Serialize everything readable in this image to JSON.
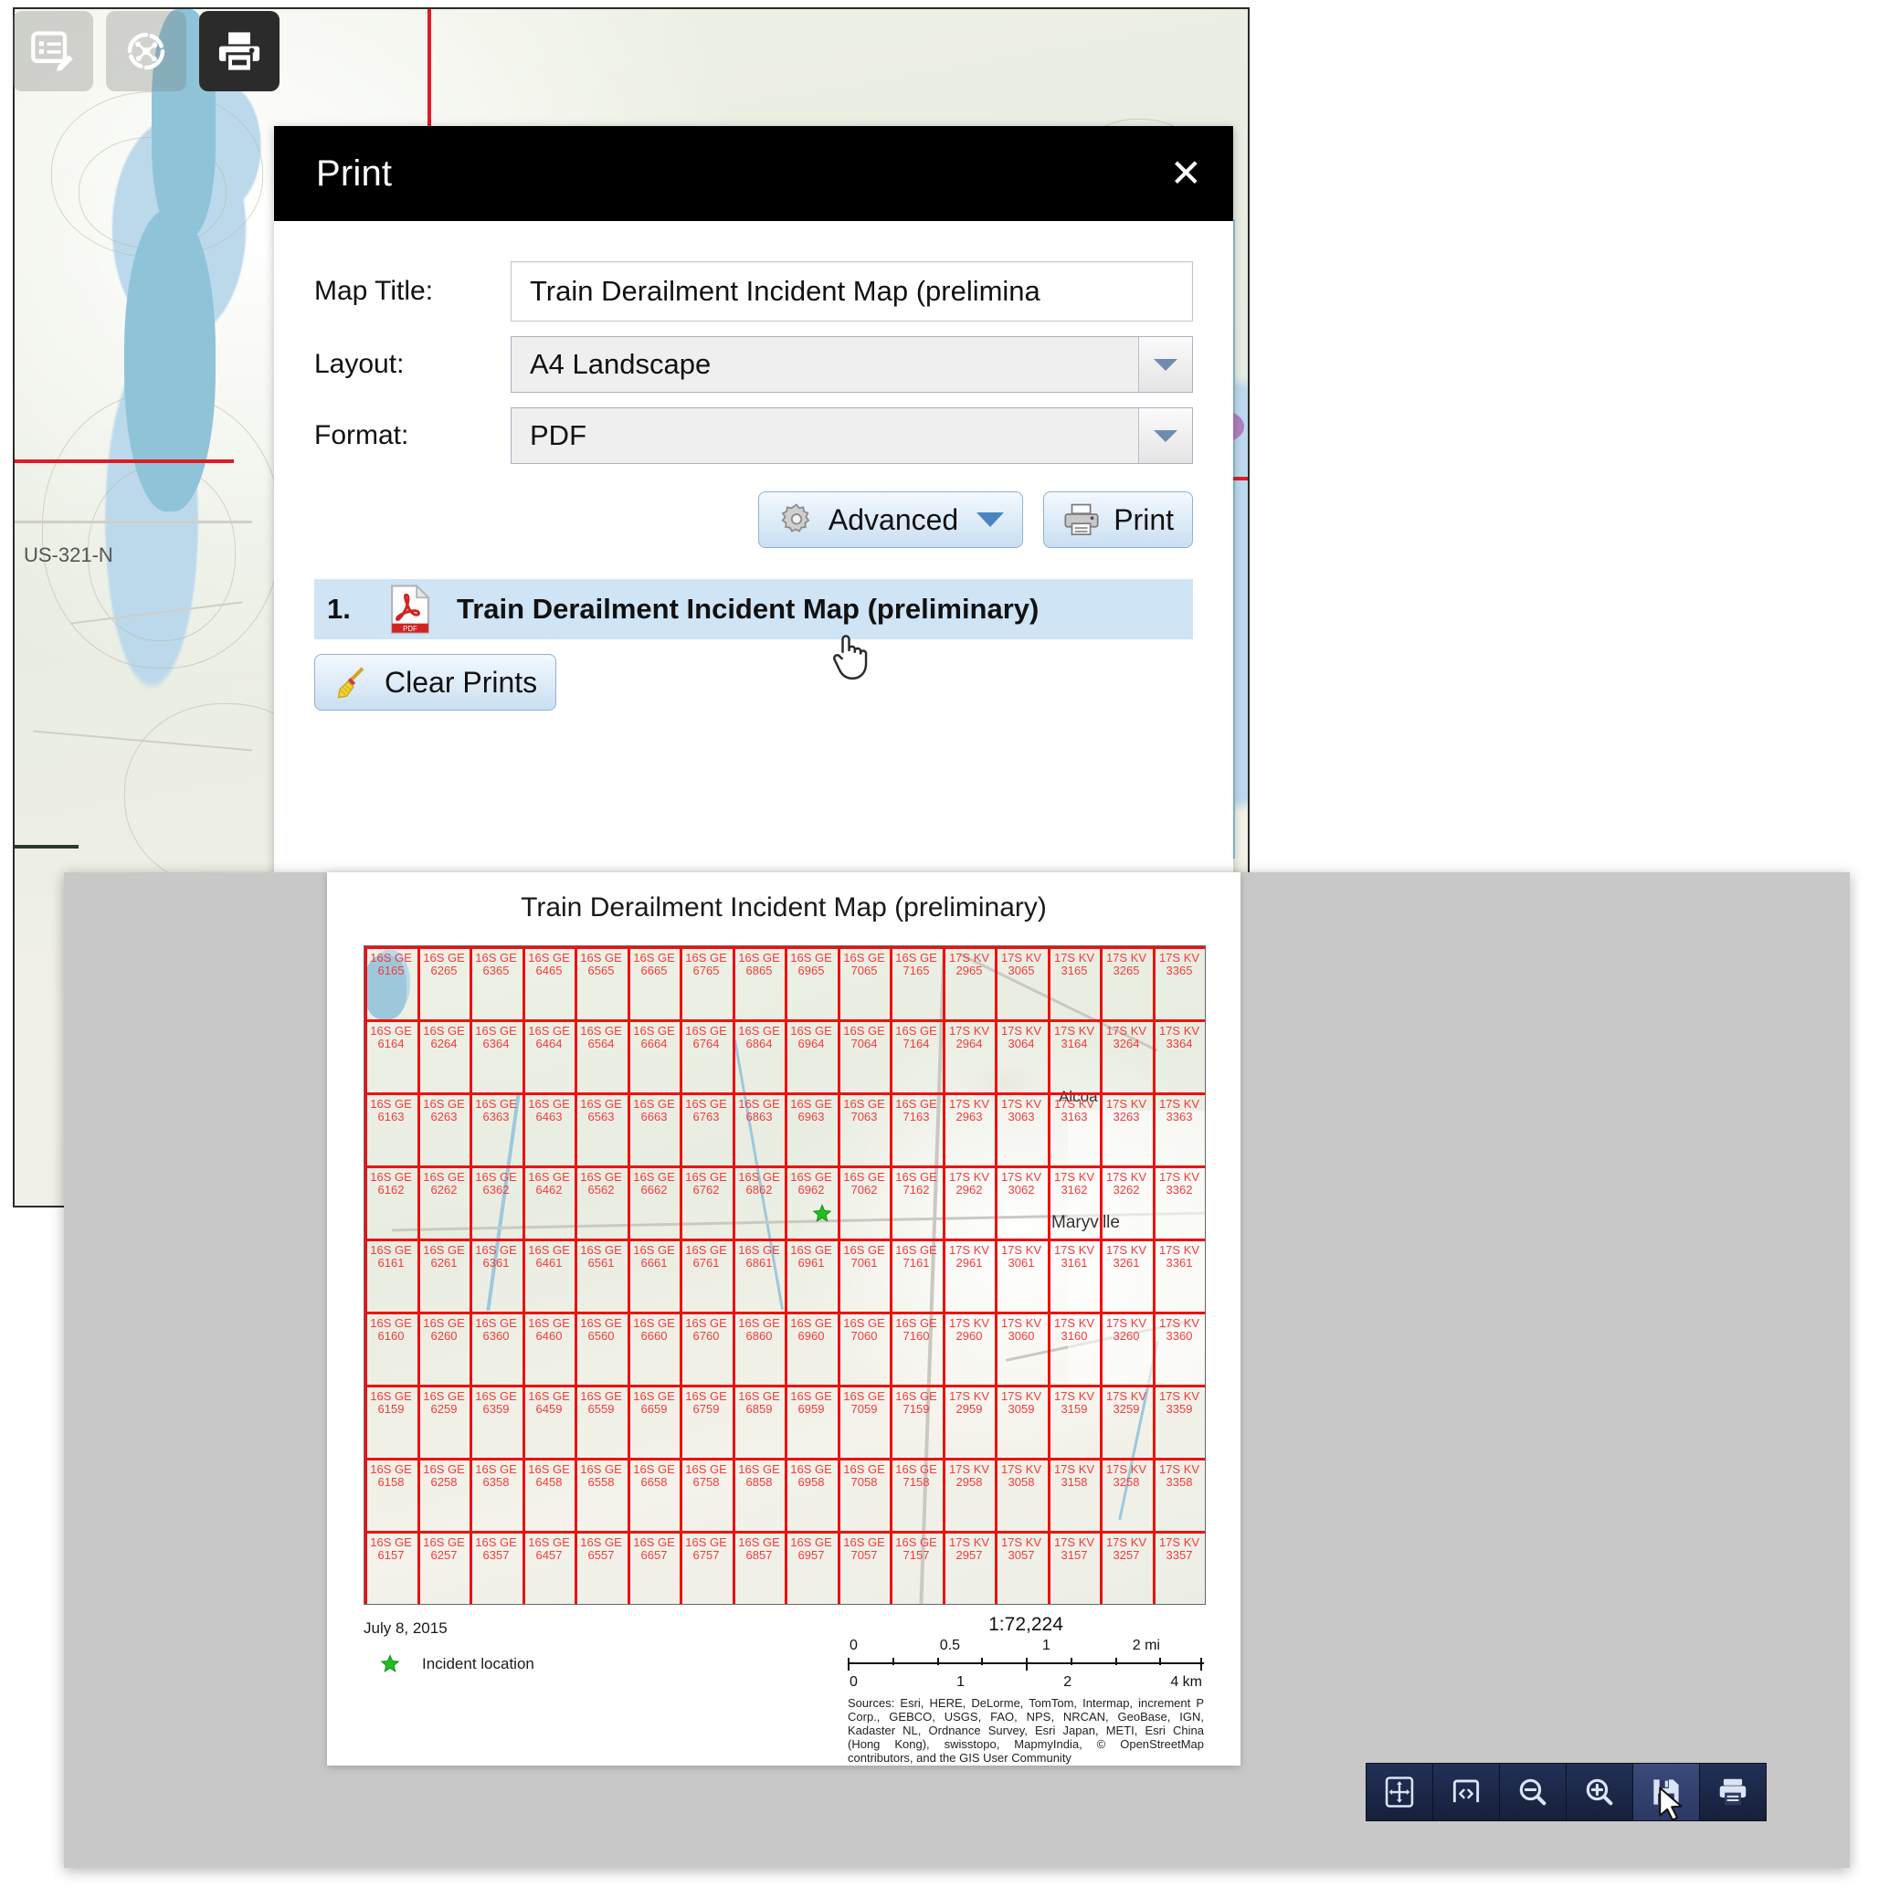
{
  "app": {
    "toolbar": [
      {
        "name": "edit-attributes-tool",
        "icon": "form-edit-icon",
        "active": false
      },
      {
        "name": "network-trace-tool",
        "icon": "network-trace-icon",
        "active": false
      },
      {
        "name": "print-tool",
        "icon": "printer-icon",
        "active": true
      }
    ]
  },
  "print_dialog": {
    "title": "Print",
    "close_label": "✕",
    "fields": {
      "map_title_label": "Map Title:",
      "map_title_value": "Train Derailment Incident Map (prelimina",
      "layout_label": "Layout:",
      "layout_value": "A4 Landscape",
      "format_label": "Format:",
      "format_value": "PDF"
    },
    "advanced_button": "Advanced",
    "print_button": "Print",
    "results": [
      {
        "number": "1.",
        "icon": "pdf-file-icon",
        "label": "Train Derailment Incident Map (preliminary)"
      }
    ],
    "clear_button": "Clear Prints"
  },
  "pdf_preview": {
    "map_title": "Train Derailment Incident Map (preliminary)",
    "date": "July 8, 2015",
    "legend": [
      {
        "symbol": "green-star",
        "label": "Incident location"
      }
    ],
    "scale": {
      "ratio": "1:72,224",
      "miles_labels": [
        "0",
        "0.5",
        "1",
        "2 mi"
      ],
      "km_labels": [
        "0",
        "1",
        "2",
        "4 km"
      ]
    },
    "attribution": "Sources: Esri, HERE, DeLorme, TomTom, Intermap, increment P Corp., GEBCO, USGS, FAO, NPS, NRCAN, GeoBase, IGN, Kadaster NL, Ordnance Survey, Esri Japan, METI, Esri China (Hong Kong), swisstopo, MapmyIndia, © OpenStreetMap contributors, and the GIS User Community",
    "place_labels": [
      "Maryville",
      "Alcoa"
    ],
    "grid": {
      "zone_left": "16S GE",
      "zone_right": "17S KV",
      "columns_left": [
        "61",
        "62",
        "63",
        "64",
        "65",
        "66",
        "67",
        "68",
        "69",
        "70",
        "71"
      ],
      "columns_right": [
        "29",
        "30",
        "31",
        "32",
        "33"
      ],
      "rows": [
        "65",
        "64",
        "63",
        "62",
        "61",
        "60",
        "59",
        "58",
        "57"
      ]
    },
    "toolbar": [
      {
        "name": "pan-tool",
        "icon": "pan-arrows-icon"
      },
      {
        "name": "fit-width-tool",
        "icon": "fit-width-icon"
      },
      {
        "name": "zoom-out-tool",
        "icon": "zoom-out-icon"
      },
      {
        "name": "zoom-in-tool",
        "icon": "zoom-in-icon"
      },
      {
        "name": "save-tool",
        "icon": "floppy-save-icon",
        "highlight": true
      },
      {
        "name": "print-tool",
        "icon": "printer-icon"
      }
    ]
  },
  "colors": {
    "grid_red": "#f01010",
    "accent_blue": "#c9dff2",
    "highlight_row": "#cfe4f5",
    "toolbar_dark": "#1b2540",
    "incident_green": "#1fbf1f"
  }
}
